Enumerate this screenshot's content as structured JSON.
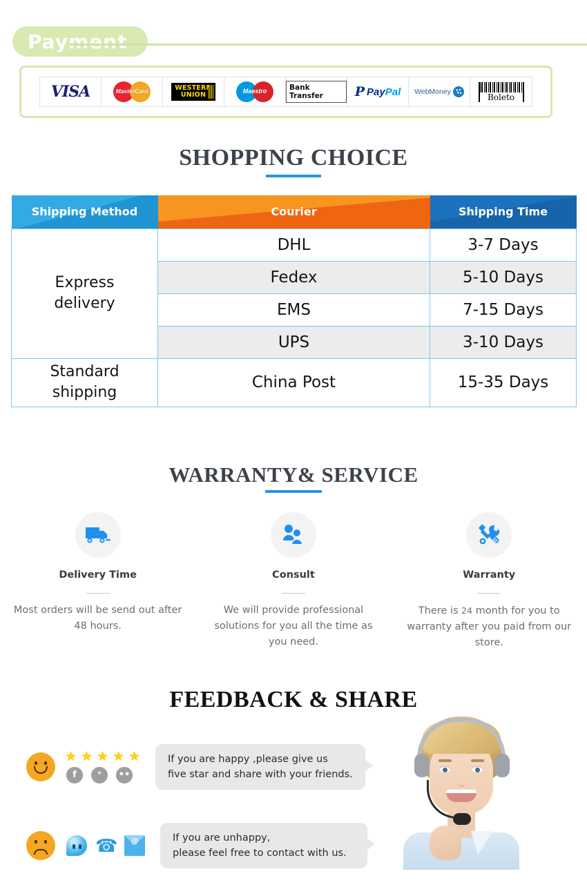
{
  "payment": {
    "badge_label": "Payment",
    "badge_bg": "#d9e9b2",
    "border_color": "#d7e8ae",
    "methods": [
      {
        "name": "VISA",
        "label": "VISA"
      },
      {
        "name": "MasterCard",
        "label": "MasterCard"
      },
      {
        "name": "Western Union",
        "line1": "WESTERN",
        "line2": "UNION"
      },
      {
        "name": "Maestro",
        "label": "Maestro"
      },
      {
        "name": "Bank Transfer",
        "label": "Bank Transfer"
      },
      {
        "name": "PayPal",
        "label1": "Pay",
        "label2": "Pal",
        "glyph": "P"
      },
      {
        "name": "WebMoney",
        "label": "WebMoney"
      },
      {
        "name": "Boleto",
        "label": "Boleto"
      }
    ]
  },
  "shopping": {
    "title": "SHOPPING CHOICE",
    "accent": "#2196e8",
    "columns": [
      "Shipping Method",
      "Courier",
      "Shipping Time"
    ],
    "header_colors": {
      "method": "#34aae3",
      "courier": "#f79520",
      "time": "#1c72be"
    },
    "rows": [
      {
        "method": "Express\ndelivery",
        "method_rowspan": 4,
        "courier": "DHL",
        "time": "3-7  Days"
      },
      {
        "courier": "Fedex",
        "time": "5-10 Days"
      },
      {
        "courier": "EMS",
        "time": "7-15 Days"
      },
      {
        "courier": "UPS",
        "time": "3-10 Days"
      },
      {
        "method": "Standard\nshipping",
        "method_rowspan": 1,
        "courier": "China Post",
        "time": "15-35 Days"
      }
    ],
    "method_express_line1": "Express",
    "method_express_line2": "delivery",
    "method_standard_line1": "Standard",
    "method_standard_line2": "shipping"
  },
  "warranty": {
    "title": "WARRANTY& SERVICE",
    "items": [
      {
        "icon": "delivery-truck-icon",
        "name": "Delivery Time",
        "text": "Most orders will be send out after 48 hours."
      },
      {
        "icon": "consult-people-icon",
        "name": "Consult",
        "text": "We will provide professional solutions for you all the time as you need."
      },
      {
        "icon": "tools-wrench-screwdriver-icon",
        "name": "Warranty",
        "text_part1": "There is",
        "text_num": "24",
        "text_part2": "month for you to warranty after you paid from our store."
      }
    ]
  },
  "feedback": {
    "title": "FEEDBACK & SHARE",
    "happy": {
      "face": "smiley-happy-icon",
      "star_count": 5,
      "star_glyph": "★",
      "socials": [
        {
          "name": "facebook-icon",
          "glyph": "f"
        },
        {
          "name": "twitter-icon",
          "glyph": "ᵛ"
        },
        {
          "name": "flickr-icon",
          "glyph": "••"
        }
      ],
      "message_line1": "If you are happy ,please give us",
      "message_line2": "five star and share with your friends."
    },
    "unhappy": {
      "face": "smiley-sad-icon",
      "contacts": [
        {
          "name": "chat-bubble-icon"
        },
        {
          "name": "phone-ringing-icon",
          "glyph": "☎"
        },
        {
          "name": "email-envelope-icon",
          "glyph": "@"
        }
      ],
      "message_line1": "If you are unhappy,",
      "message_line2": "please feel free to contact with us."
    },
    "agent_photo_alt": "customer-service-agent-photo"
  }
}
